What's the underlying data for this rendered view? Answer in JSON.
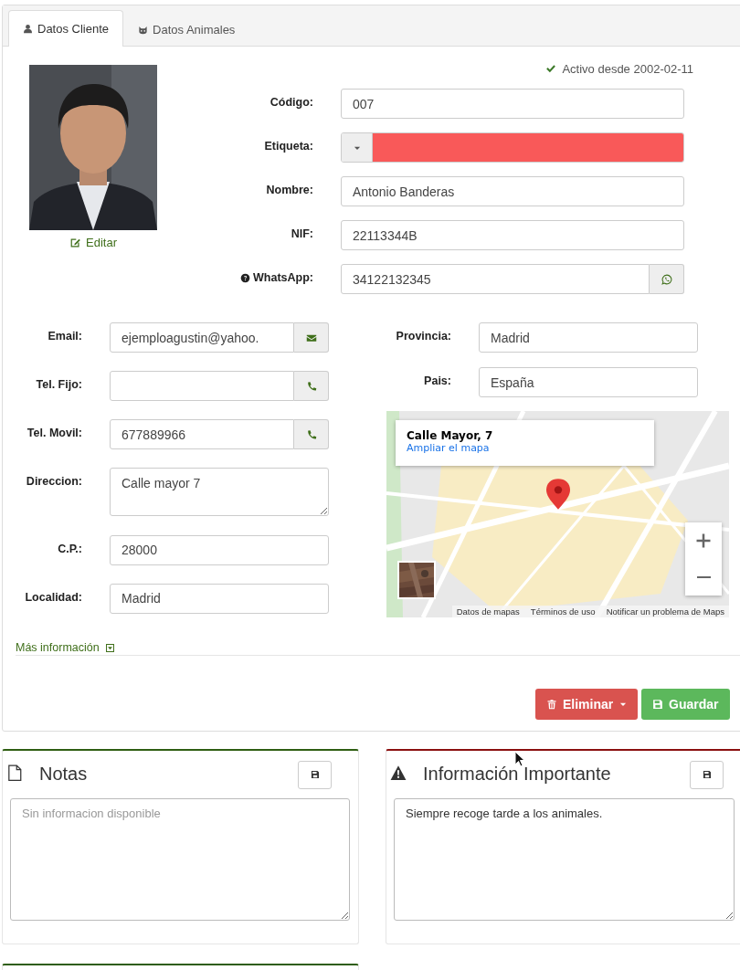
{
  "tabs": [
    {
      "label": "Datos Cliente",
      "selected": true
    },
    {
      "label": "Datos Animales",
      "selected": false
    }
  ],
  "status": {
    "text": "Activo desde 2002-02-11",
    "active": true
  },
  "photo": {
    "kind": "picture",
    "edit_link": "Editar"
  },
  "main_fields": [
    {
      "label": "Código:",
      "kind": "text",
      "value": "007"
    },
    {
      "label": "Etiqueta:",
      "kind": "tag",
      "color": "#f95959"
    },
    {
      "label": "Nombre:",
      "kind": "text",
      "value": "Antonio Banderas"
    },
    {
      "label": "NIF:",
      "kind": "text",
      "value": "22113344B"
    },
    {
      "label": "WhatsApp:",
      "kind": "whatsapp",
      "help": true,
      "value": "34122132345"
    }
  ],
  "contact_fields": [
    {
      "label": "Email:",
      "kind": "email",
      "value": "ejemploagustin@yahoo."
    },
    {
      "label": "Tel. Fijo:",
      "kind": "phone"
    },
    {
      "label": "Tel. Movil:",
      "kind": "phone",
      "value": "677889966"
    },
    {
      "label": "Direccion:",
      "kind": "textarea",
      "value": "Calle mayor 7"
    },
    {
      "label": "C.P.:",
      "kind": "text",
      "value": "28000"
    },
    {
      "label": "Localidad:",
      "kind": "text",
      "value": "Madrid"
    }
  ],
  "location_fields": [
    {
      "label": "Provincia:",
      "kind": "text",
      "value": "Madrid"
    },
    {
      "label": "Pais:",
      "kind": "text",
      "value": "España"
    }
  ],
  "map": {
    "place": "Calle Mayor, 7",
    "enlarge_link": "Ampliar el mapa",
    "footer": [
      "Datos de mapas",
      "Términos de uso",
      "Notificar un problema de Maps"
    ]
  },
  "more_info": {
    "label": "Más información",
    "expanded": false
  },
  "actions": [
    {
      "label": "Eliminar",
      "kind": "danger",
      "dropdown": true
    },
    {
      "label": "Guardar",
      "kind": "success",
      "dropdown": false
    }
  ],
  "notes": [
    {
      "title": "Notas",
      "color": "#2e5e12",
      "placeholder": "Sin informacion disponible"
    },
    {
      "title": "Información Importante",
      "color": "#8b0f0f",
      "value": "Siempre recoge tarde a los animales."
    }
  ]
}
